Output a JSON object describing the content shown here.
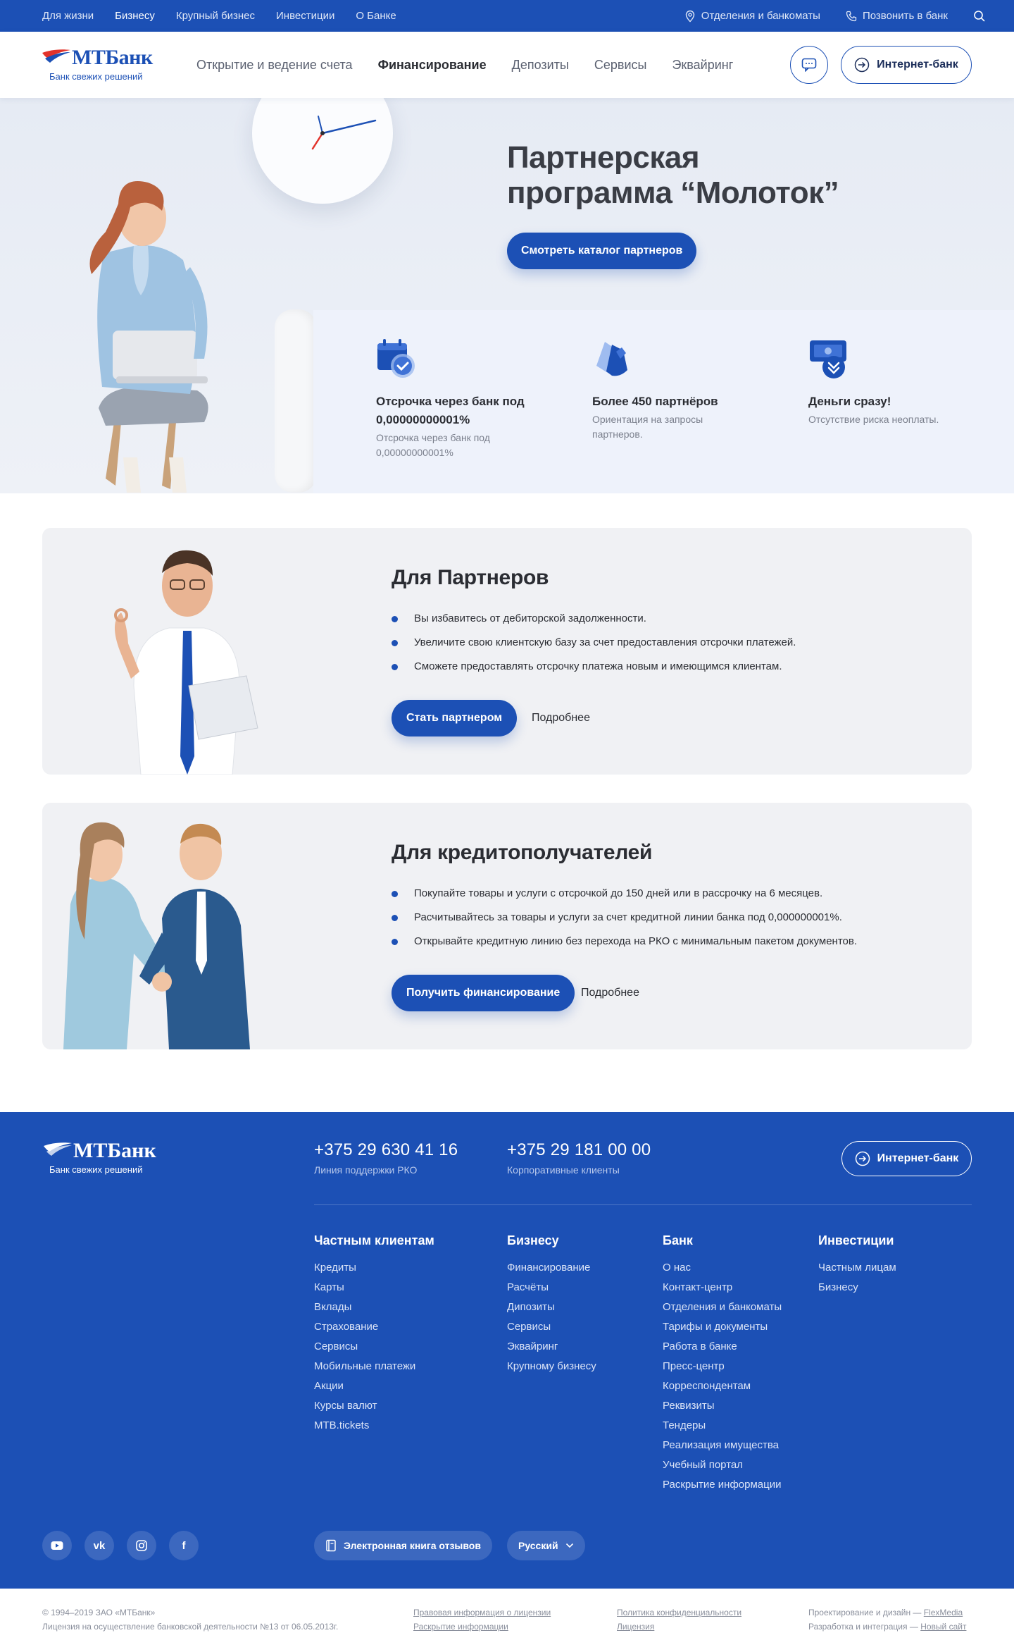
{
  "topbar": {
    "links": [
      "Для жизни",
      "Бизнесу",
      "Крупный бизнес",
      "Инвестиции",
      "О Банке"
    ],
    "active_index": 1,
    "branches": "Отделения и банкоматы",
    "call": "Позвонить в банк"
  },
  "header": {
    "logo_name": "МТБанк",
    "logo_tagline": "Банк свежих решений",
    "nav": [
      "Открытие и ведение счета",
      "Финансирование",
      "Депозиты",
      "Сервисы",
      "Эквайринг"
    ],
    "nav_active_index": 1,
    "internet_bank": "Интернет-банк"
  },
  "hero": {
    "title_line1": "Партнерская",
    "title_line2": "программа “Молоток”",
    "button": "Смотреть каталог партнеров",
    "features": [
      {
        "icon": "calendar-check-icon",
        "title": "Отсрочка через банк под 0,00000000001%",
        "desc": "Отсрочка через банк под 0,00000000001%"
      },
      {
        "icon": "handshake-icon",
        "title": "Более 450 партнёров",
        "desc": "Ориентация на запросы партнеров."
      },
      {
        "icon": "money-down-icon",
        "title": "Деньги сразу!",
        "desc": "Отсутствие риска неоплаты."
      }
    ]
  },
  "partners": {
    "title": "Для Партнеров",
    "items": [
      "Вы избавитесь от дебиторской задолженности.",
      "Увеличите свою клиентскую базу за счет предоставления отсрочки платежей.",
      "Сможете предоставлять отсрочку платежа новым и имеющимся клиентам."
    ],
    "cta": "Стать партнером",
    "more": "Подробнее"
  },
  "borrowers": {
    "title": "Для кредитополучателей",
    "items": [
      "Покупайте товары и услуги с отсрочкой до 150 дней или в рассрочку на 6 месяцев.",
      "Расчитывайтесь за товары и услуги за счет кредитной линии банка под 0,000000001%.",
      "Открывайте кредитную линию без перехода на РКО с минимальным пакетом документов."
    ],
    "cta": "Получить финансирование",
    "more": "Подробнее"
  },
  "footer": {
    "logo_name": "МТБанк",
    "logo_tagline": "Банк свежих решений",
    "phones": [
      {
        "number": "+375 29 630 41 16",
        "label": "Линия поддержки РКО"
      },
      {
        "number": "+375 29 181 00 00",
        "label": "Корпоративные клиенты"
      }
    ],
    "internet_bank": "Интернет-банк",
    "columns": [
      {
        "heading": "Частным клиентам",
        "items": [
          "Кредиты",
          "Карты",
          "Вклады",
          "Страхование",
          "Сервисы",
          "Мобильные платежи",
          "Акции",
          "Курсы валют",
          "MTB.tickets"
        ]
      },
      {
        "heading": "Бизнесу",
        "items": [
          "Финансирование",
          "Расчёты",
          "Дипозиты",
          "Сервисы",
          "Эквайринг",
          "Крупному бизнесу"
        ]
      },
      {
        "heading": "Банк",
        "items": [
          "О нас",
          "Контакт-центр",
          "Отделения и банкоматы",
          "Тарифы и документы",
          "Работа в банке",
          "Пресс-центр",
          "Корреспондентам",
          "Реквизиты",
          "Тендеры",
          "Реализация имущества",
          "Учебный портал",
          "Раскрытие информации"
        ]
      },
      {
        "heading": "Инвестиции",
        "items": [
          "Частным лицам",
          "Бизнесу"
        ]
      }
    ],
    "socials": [
      {
        "icon": "youtube-icon",
        "glyph": "▶"
      },
      {
        "icon": "vk-icon",
        "glyph": "vk"
      },
      {
        "icon": "instagram-icon",
        "glyph": "◎"
      },
      {
        "icon": "facebook-icon",
        "glyph": "f"
      }
    ],
    "reviews_book": "Электронная книга отзывов",
    "language": "Русский"
  },
  "bottom": {
    "copyright": "© 1994–2019 ЗАО «МТБанк»",
    "license": "Лицензия на осуществление банковской деятельности №13 от 06.05.2013г.",
    "legal_info": "Правовая информация о лицензии",
    "disclosure": "Раскрытие информации",
    "privacy": "Политика конфиденциальности",
    "license_link": "Лицензия",
    "design_label": "Проектирование и дизайн —",
    "design_by": "FlexMedia",
    "dev_label": "Разработка и интеграция —",
    "dev_by": "Новый сайт"
  },
  "colors": {
    "brand": "#1c50b5",
    "hero_bg": "#e6ebf4",
    "card_bg": "#f0f1f4"
  }
}
